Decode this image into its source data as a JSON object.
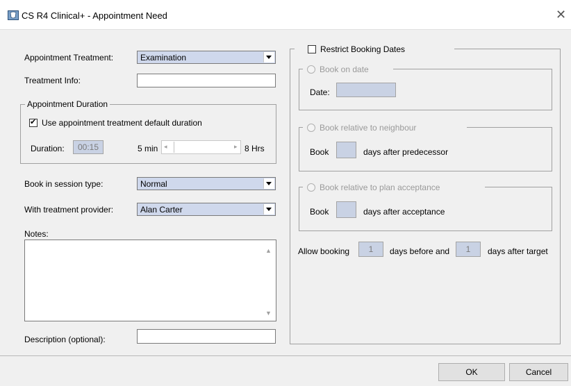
{
  "window": {
    "title": "CS R4 Clinical+ - Appointment Need",
    "close_glyph": "✕"
  },
  "left": {
    "appointment_treatment": {
      "label": "Appointment Treatment:",
      "value": "Examination"
    },
    "treatment_info": {
      "label": "Treatment Info:",
      "value": ""
    },
    "duration_group": {
      "title": "Appointment Duration",
      "use_default_label": "Use appointment treatment default duration",
      "use_default_checked": true,
      "duration_label": "Duration:",
      "duration_value": "00:15",
      "slider_min_label": "5 min",
      "slider_max_label": "8 Hrs",
      "slider_left_arrow": "◂",
      "slider_right_arrow": "▸"
    },
    "session_type": {
      "label": "Book in session type:",
      "value": "Normal"
    },
    "provider": {
      "label": "With treatment provider:",
      "value": "Alan Carter"
    },
    "notes": {
      "label": "Notes:",
      "value": "",
      "scroll_up": "▲",
      "scroll_down": "▼"
    },
    "description": {
      "label": "Description (optional):",
      "value": ""
    }
  },
  "right": {
    "restrict": {
      "label": "Restrict Booking Dates",
      "checked": false
    },
    "book_on_date": {
      "title": "Book on date",
      "date_label": "Date:",
      "date_value": ""
    },
    "book_relative_neighbour": {
      "title": "Book relative to neighbour",
      "book_label": "Book",
      "days_value": "",
      "after_label": "days after predecessor"
    },
    "book_relative_plan": {
      "title": "Book relative to plan acceptance",
      "book_label": "Book",
      "days_value": "",
      "after_label": "days after acceptance"
    },
    "allow": {
      "prefix": "Allow booking",
      "before_value": "1",
      "middle": "days before and",
      "after_value": "1",
      "suffix": "days after target"
    }
  },
  "buttons": {
    "ok": "OK",
    "cancel": "Cancel"
  }
}
